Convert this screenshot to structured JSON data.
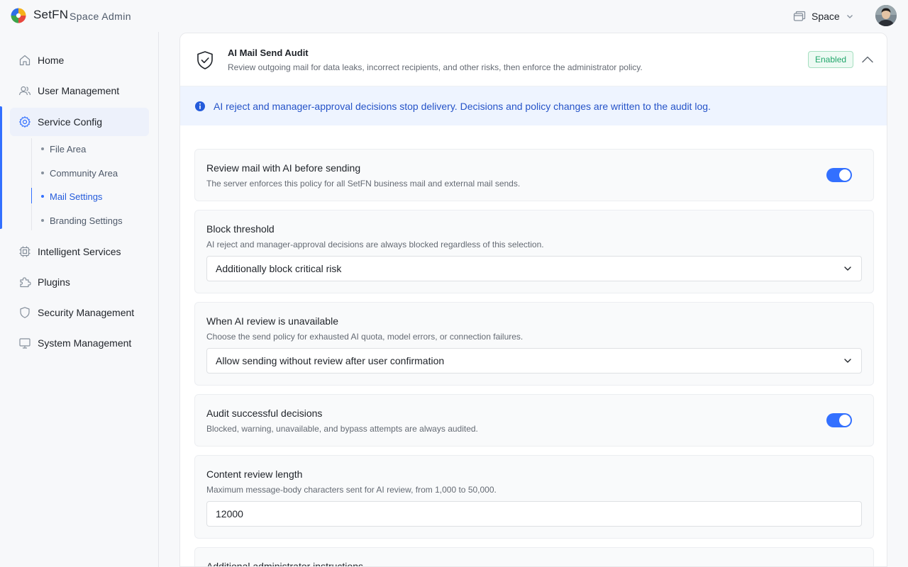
{
  "header": {
    "brand": "SetFN",
    "brand_sub": "Space Admin",
    "space_label": "Space",
    "icons": {
      "logo": "setfn-logo",
      "space": "window-stack-icon",
      "chevron": "chevron-down-icon",
      "avatar": "user-avatar"
    }
  },
  "sidebar": {
    "items": [
      {
        "label": "Home",
        "icon": "home-icon"
      },
      {
        "label": "User Management",
        "icon": "users-icon"
      },
      {
        "label": "Service Config",
        "icon": "gear-icon",
        "active": true
      },
      {
        "label": "Intelligent Services",
        "icon": "chip-icon"
      },
      {
        "label": "Plugins",
        "icon": "puzzle-icon"
      },
      {
        "label": "Security Management",
        "icon": "shield-icon"
      },
      {
        "label": "System Management",
        "icon": "monitor-icon"
      }
    ],
    "sub_items": [
      {
        "label": "File Area"
      },
      {
        "label": "Community Area"
      },
      {
        "label": "Mail Settings",
        "active": true
      },
      {
        "label": "Branding Settings"
      }
    ]
  },
  "card": {
    "title": "AI Mail Send Audit",
    "description": "Review outgoing mail for data leaks, incorrect recipients, and other risks, then enforce the administrator policy.",
    "status_badge": "Enabled",
    "info": "AI reject and manager-approval decisions stop delivery. Decisions and policy changes are written to the audit log."
  },
  "settings": {
    "review_before_send": {
      "title": "Review mail with AI before sending",
      "description": "The server enforces this policy for all SetFN business mail and external mail sends.",
      "enabled": true
    },
    "block_threshold": {
      "title": "Block threshold",
      "description": "AI reject and manager-approval decisions are always blocked regardless of this selection.",
      "value": "Additionally block critical risk"
    },
    "unavailable_policy": {
      "title": "When AI review is unavailable",
      "description": "Choose the send policy for exhausted AI quota, model errors, or connection failures.",
      "value": "Allow sending without review after user confirmation"
    },
    "audit_success": {
      "title": "Audit successful decisions",
      "description": "Blocked, warning, unavailable, and bypass attempts are always audited.",
      "enabled": true
    },
    "content_length": {
      "title": "Content review length",
      "description": "Maximum message-body characters sent for AI review, from 1,000 to 50,000.",
      "value": "12000"
    },
    "admin_instructions": {
      "title": "Additional administrator instructions"
    }
  },
  "colors": {
    "accent": "#3370ff",
    "success": "#21a66b",
    "info_bg": "#eef4ff"
  }
}
